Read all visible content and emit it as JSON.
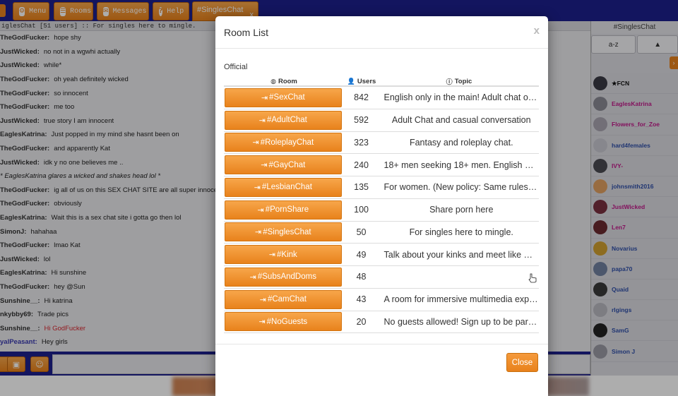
{
  "toolbar": {
    "buttons": [
      {
        "label": "Menu",
        "icon": "gear-icon"
      },
      {
        "label": "Rooms",
        "icon": "list-icon"
      },
      {
        "label": "Messages",
        "icon": "envelope-icon"
      },
      {
        "label": "Help",
        "icon": "question-icon"
      }
    ],
    "active_tab": "#SinglesChat",
    "tab_close": "x"
  },
  "chat": {
    "topic_line": "iglesChat [51 users] :: For singles here to mingle.",
    "messages": [
      {
        "nick": "TheGodFucker:",
        "text": "hope shy",
        "style": "normal"
      },
      {
        "nick": "JustWicked:",
        "text": "no not in a wgwhi actually",
        "style": "normal"
      },
      {
        "nick": "JustWicked:",
        "text": "while*",
        "style": "normal"
      },
      {
        "nick": "TheGodFucker:",
        "text": "oh yeah definitely wicked",
        "style": "normal"
      },
      {
        "nick": "TheGodFucker:",
        "text": "so innocent",
        "style": "normal"
      },
      {
        "nick": "TheGodFucker:",
        "text": "me too",
        "style": "normal"
      },
      {
        "nick": "JustWicked:",
        "text": "true story I am innocent",
        "style": "normal"
      },
      {
        "nick": "EaglesKatrina:",
        "text": "Just popped in my mind she hasnt been on",
        "style": "normal"
      },
      {
        "nick": "TheGodFucker:",
        "text": "and apparently Kat",
        "style": "normal"
      },
      {
        "nick": "JustWicked:",
        "text": "idk y no one believes me ..",
        "style": "normal"
      },
      {
        "nick": "",
        "text": "* EaglesKatrina glares a wicked and shakes head lol *",
        "style": "action"
      },
      {
        "nick": "TheGodFucker:",
        "text": "ig all of us on this SEX CHAT SITE are all super innocent",
        "style": "normal"
      },
      {
        "nick": "TheGodFucker:",
        "text": "obviously",
        "style": "normal"
      },
      {
        "nick": "EaglesKatrina:",
        "text": "Wait this is a sex chat site i gotta go then lol",
        "style": "normal"
      },
      {
        "nick": "SimonJ:",
        "text": "hahahaa",
        "style": "normal"
      },
      {
        "nick": "TheGodFucker:",
        "text": "lmao Kat",
        "style": "normal"
      },
      {
        "nick": "JustWicked:",
        "text": "lol",
        "style": "normal"
      },
      {
        "nick": "EaglesKatrina:",
        "text": "Hi sunshine",
        "style": "normal"
      },
      {
        "nick": "TheGodFucker:",
        "text": "hey @Sun",
        "style": "normal"
      },
      {
        "nick": "Sunshine__:",
        "text": "Hi katrina",
        "style": "normal"
      },
      {
        "nick": "nkybby69:",
        "text": "Trade pics",
        "style": "normal"
      },
      {
        "nick": "Sunshine__:",
        "text": "Hi GodFucker",
        "style": "red"
      },
      {
        "nick": "yalPeasant:",
        "text": "Hey girls",
        "style": "blue"
      }
    ]
  },
  "users_panel": {
    "title": "#SinglesChat",
    "sort_az": "a-z",
    "sort_arrow": "▲",
    "users": [
      {
        "name": "★FCN",
        "color": "#111111"
      },
      {
        "name": "EaglesKatrina",
        "color": "#c2188a"
      },
      {
        "name": "Flowers_for_Zoe",
        "color": "#c2188a"
      },
      {
        "name": "hard4females",
        "color": "#2f4fa8"
      },
      {
        "name": "IVY-",
        "color": "#c2188a"
      },
      {
        "name": "johnsmith2016",
        "color": "#2f4fa8"
      },
      {
        "name": "JustWicked",
        "color": "#c2188a"
      },
      {
        "name": "Len7",
        "color": "#c2188a"
      },
      {
        "name": "Novarius",
        "color": "#2f4fa8"
      },
      {
        "name": "papa70",
        "color": "#2f4fa8"
      },
      {
        "name": "Quaid",
        "color": "#2f4fa8"
      },
      {
        "name": "rlgings",
        "color": "#2f4fa8"
      },
      {
        "name": "SamG",
        "color": "#2f4fa8"
      },
      {
        "name": "Simon J",
        "color": "#2f4fa8"
      }
    ]
  },
  "modal": {
    "title": "Room List",
    "close_x": "x",
    "section": "Official",
    "columns": {
      "room": "Room",
      "users": "Users",
      "topic": "Topic"
    },
    "rooms": [
      {
        "name": "#SexChat",
        "users": "842",
        "topic": "English only in the main! Adult chat of…",
        "center": false
      },
      {
        "name": "#AdultChat",
        "users": "592",
        "topic": "Adult Chat and casual conversation",
        "center": true
      },
      {
        "name": "#RoleplayChat",
        "users": "323",
        "topic": "Fantasy and roleplay chat.",
        "center": true
      },
      {
        "name": "#GayChat",
        "users": "240",
        "topic": "18+ men seeking 18+ men. English O…",
        "center": false
      },
      {
        "name": "#LesbianChat",
        "users": "135",
        "topic": "For women. (New policy: Same rules …",
        "center": false
      },
      {
        "name": "#PornShare",
        "users": "100",
        "topic": "Share porn here",
        "center": true
      },
      {
        "name": "#SinglesChat",
        "users": "50",
        "topic": "For singles here to mingle.",
        "center": true
      },
      {
        "name": "#Kink",
        "users": "49",
        "topic": "Talk about your kinks and meet like m…",
        "center": false
      },
      {
        "name": "#SubsAndDoms",
        "users": "48",
        "topic": "",
        "center": false
      },
      {
        "name": "#CamChat",
        "users": "43",
        "topic": "A room for immersive multimedia exp…",
        "center": false
      },
      {
        "name": "#NoGuests",
        "users": "20",
        "topic": "No guests allowed! Sign up to be part…",
        "center": false
      }
    ],
    "close_label": "Close"
  },
  "colors": {
    "accent": "#e8821c",
    "navy": "#1c1f8c"
  }
}
